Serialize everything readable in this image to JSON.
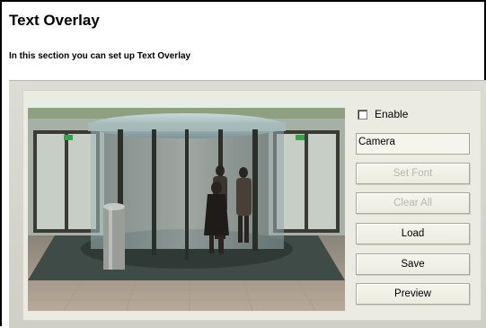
{
  "page": {
    "title": "Text Overlay",
    "subtitle": "In this section you can set up Text Overlay"
  },
  "controls": {
    "enable_label": "Enable",
    "enable_checked": false,
    "text_value": "Camera",
    "buttons": [
      {
        "label": "Set Font",
        "enabled": false
      },
      {
        "label": "Clear All",
        "enabled": false
      },
      {
        "label": "Load",
        "enabled": true
      },
      {
        "label": "Save",
        "enabled": true
      },
      {
        "label": "Preview",
        "enabled": true
      }
    ]
  },
  "colors": {
    "panel_bg": "#dcdcd4",
    "inner_bg": "#ecebe1",
    "button_bg": "#f6f5ec",
    "disabled_text": "#b8b7ad"
  }
}
